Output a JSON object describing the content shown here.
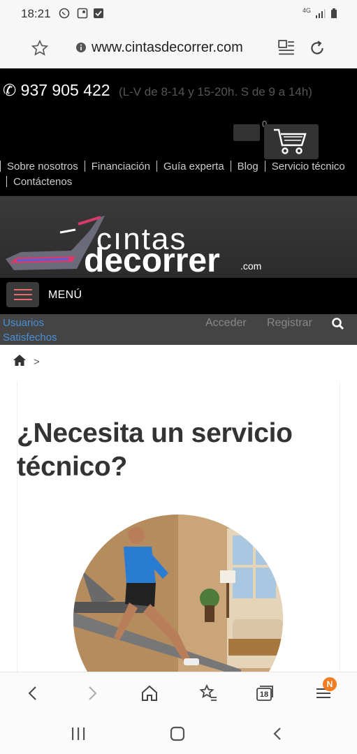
{
  "status_bar": {
    "time": "18:21",
    "network": "4G"
  },
  "browser": {
    "url": "www.cintasdecorrer.com",
    "tab_count": "18",
    "menu_badge": "N"
  },
  "header": {
    "phone": "937 905 422",
    "hours": "(L-V de 8-14 y 15-20h. S de 9 a 14h)",
    "cart_count": "0",
    "nav_items": [
      {
        "label": "Sobre nosotros"
      },
      {
        "label": "Financiación"
      },
      {
        "label": "Guía experta"
      },
      {
        "label": "Blog"
      },
      {
        "label": "Servicio técnico"
      },
      {
        "label": "Contáctenos"
      }
    ]
  },
  "logo": {
    "word1": "cıntas",
    "word2": "decorrer",
    "suffix": ".com"
  },
  "menu": {
    "label": "MENÚ"
  },
  "user_bar": {
    "satisfied_line1": "Usuarios",
    "satisfied_line2": "Satisfechos",
    "login": "Acceder",
    "register": "Registrar"
  },
  "breadcrumb": {
    "separator": ">"
  },
  "main": {
    "title": "¿Necesita un servicio técnico?"
  },
  "colors": {
    "accent_red": "#e86a6a",
    "link_blue": "#4a8fd6",
    "badge_orange": "#f07d22"
  }
}
